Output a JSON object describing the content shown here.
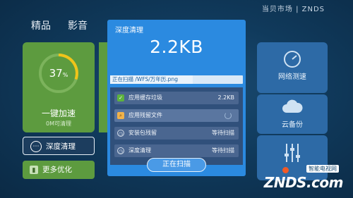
{
  "nav": {
    "tabs": [
      "精品",
      "影音"
    ],
    "brand": "当贝市场 | ZNDS"
  },
  "booster": {
    "percent": "37",
    "percent_unit": "%",
    "title": "一键加速",
    "subtitle": "0M可清理"
  },
  "side_buttons": {
    "deep_clean": "深度清理",
    "more_optimize": "更多优化"
  },
  "right_tiles": {
    "network": "网络测速",
    "cloud_backup": "云备份"
  },
  "dialog": {
    "title": "深度清理",
    "size": "2.2KB",
    "scanning_path": "正在扫描 /WFS/万年历.png",
    "progress": 0.62,
    "items": [
      {
        "label": "应用缓存垃圾",
        "value": "2.2KB",
        "status": "done"
      },
      {
        "label": "应用残留文件",
        "value": "",
        "status": "scanning"
      },
      {
        "label": "安装包残留",
        "value": "等待扫描",
        "status": "waiting"
      },
      {
        "label": "深度清理",
        "value": "等待扫描",
        "status": "waiting"
      }
    ],
    "button": "正在扫描"
  },
  "watermark": {
    "tag": "智能电视网",
    "text": "ZNDS.com"
  },
  "colors": {
    "green": "#5d9b3f",
    "dialog_blue": "#2b8ae0",
    "tile_blue": "#2d6aa6",
    "background": "#103a5c"
  }
}
